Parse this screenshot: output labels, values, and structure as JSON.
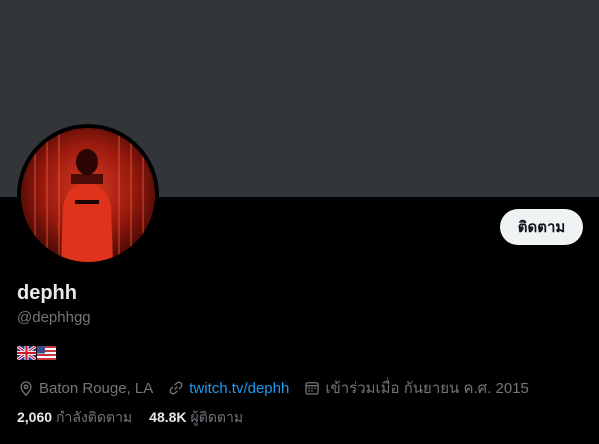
{
  "profile": {
    "display_name": "dephh",
    "handle": "@dephhgg",
    "bio_flags": [
      "uk-flag-icon",
      "us-flag-icon"
    ],
    "follow_button_label": "ติดตาม",
    "location": "Baton Rouge, LA",
    "website": "twitch.tv/dephh",
    "joined": "เข้าร่วมเมื่อ กันยายน ค.ศ. 2015",
    "following_count": "2,060",
    "following_label": "กำลังติดตาม",
    "followers_count": "48.8K",
    "followers_label": "ผู้ติดตาม"
  },
  "colors": {
    "background": "#000000",
    "banner": "#333639",
    "text_primary": "#e7e9ea",
    "text_secondary": "#71767b",
    "link": "#1d9bf0",
    "button_bg": "#eff3f4"
  },
  "icons": {
    "location": "location-pin-icon",
    "website": "link-icon",
    "joined": "calendar-icon"
  }
}
